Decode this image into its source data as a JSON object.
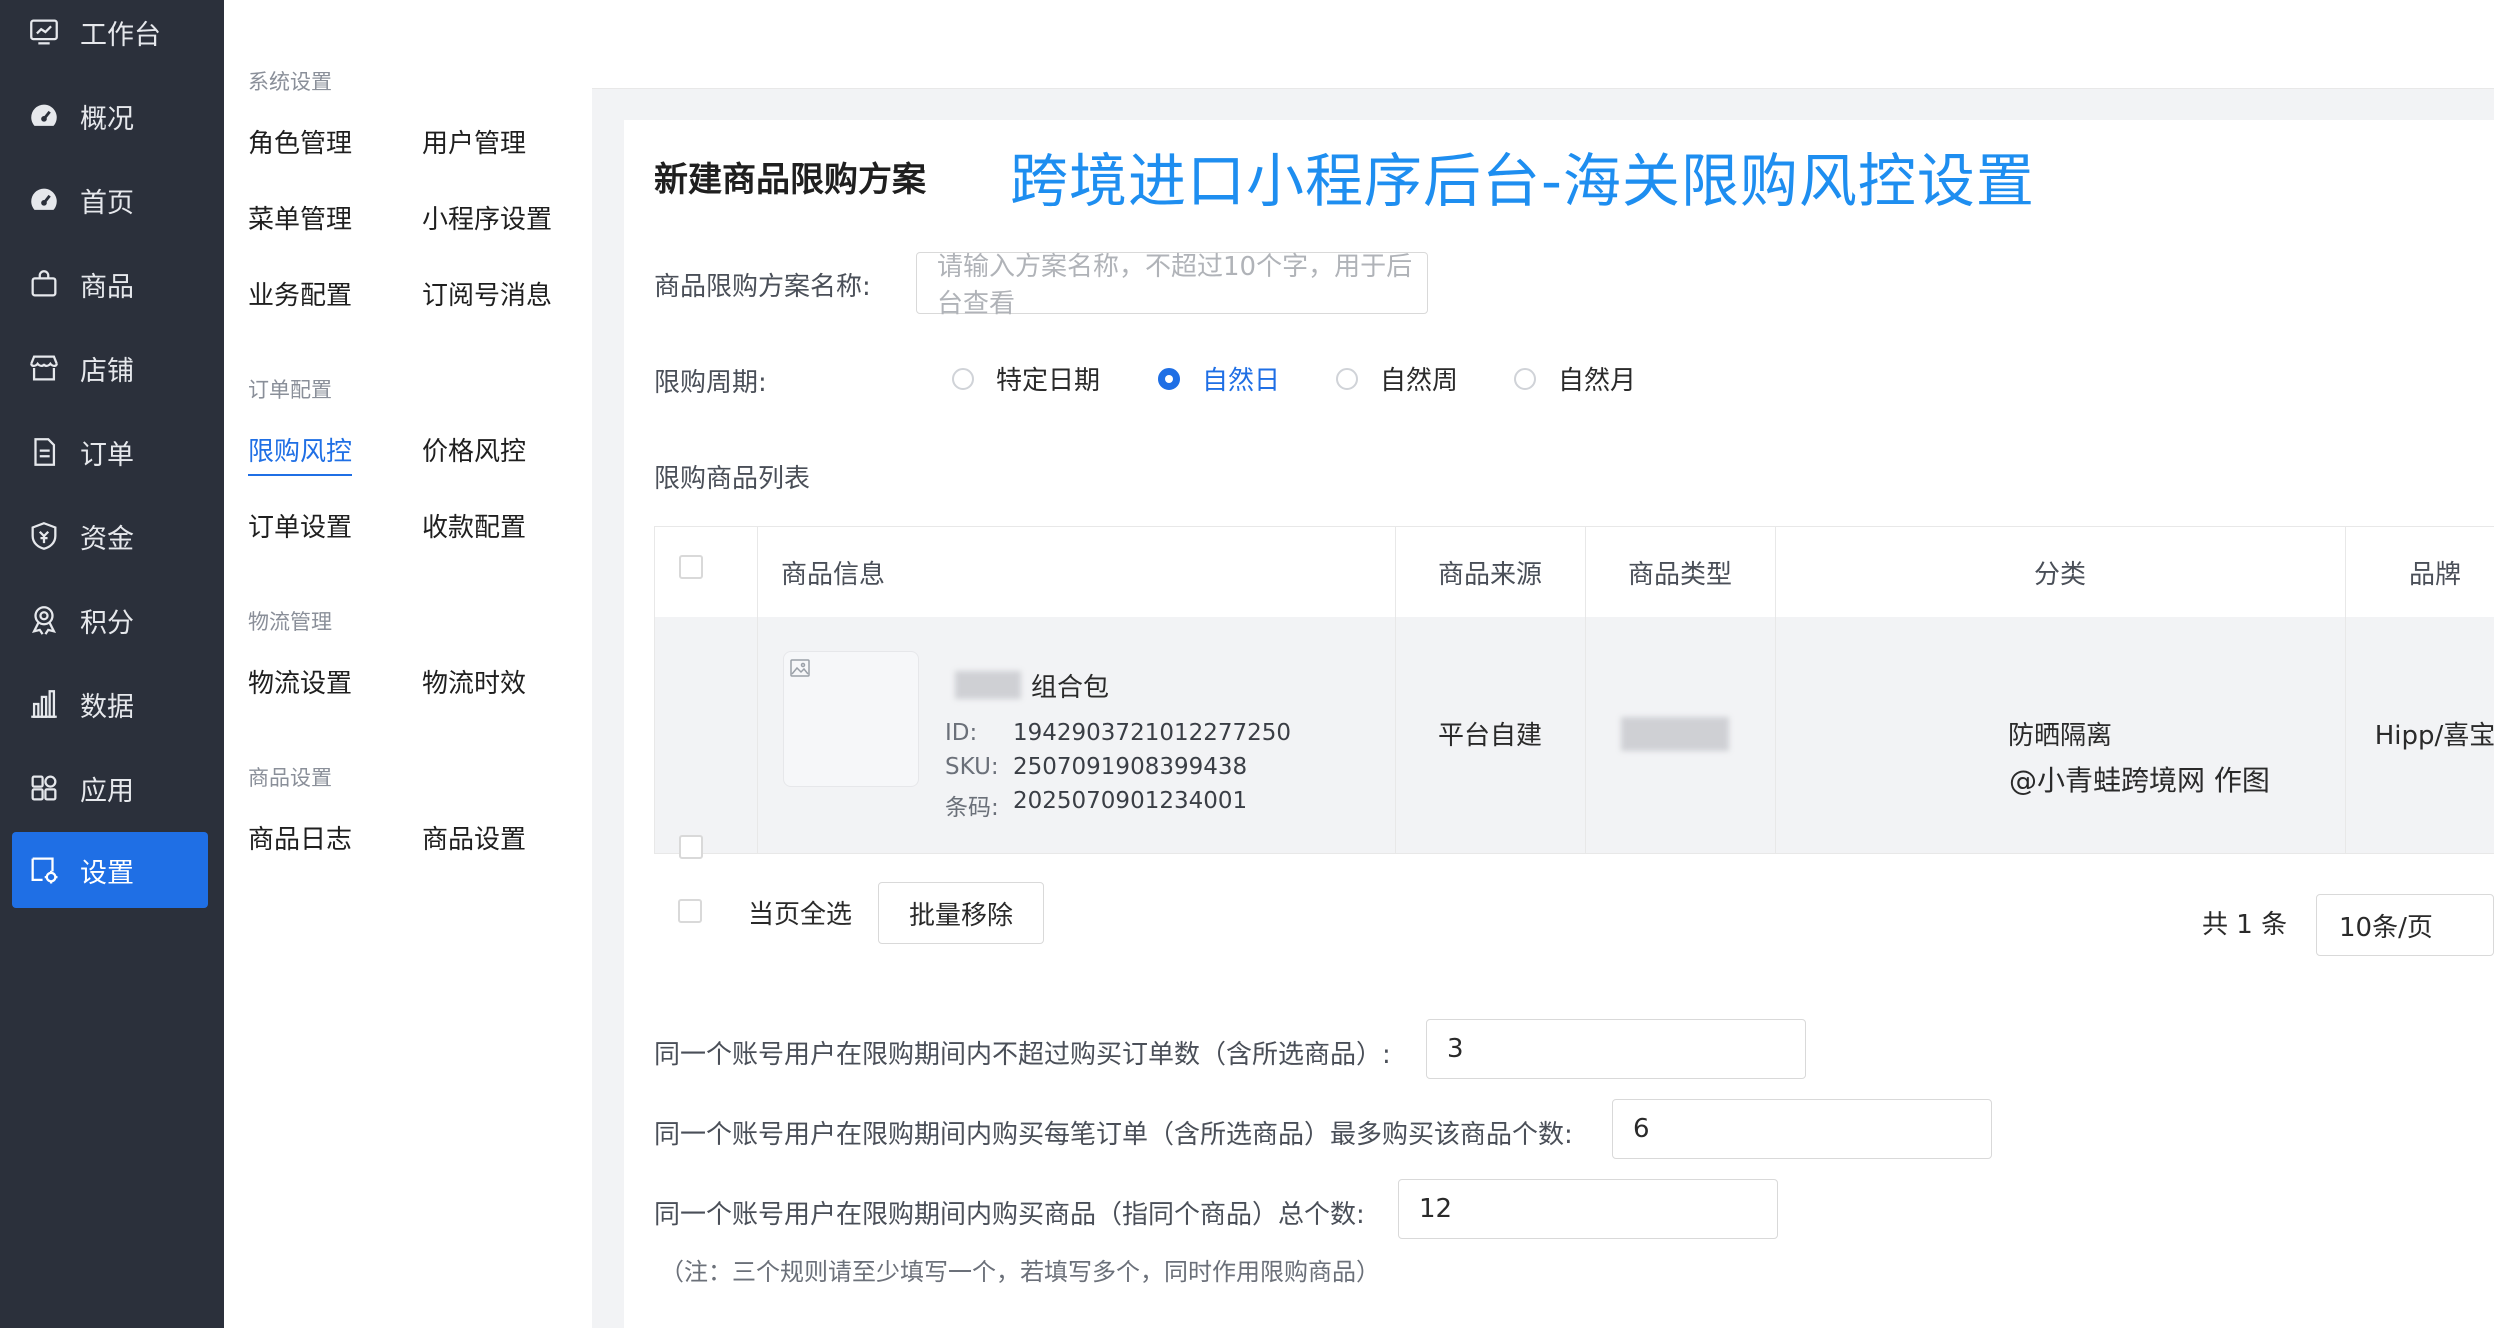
{
  "sidebar": {
    "items": [
      {
        "label": "工作台",
        "icon": "monitor-icon"
      },
      {
        "label": "概况",
        "icon": "dashboard-gauge-icon"
      },
      {
        "label": "首页",
        "icon": "home-gauge-icon"
      },
      {
        "label": "商品",
        "icon": "shopping-bag-icon"
      },
      {
        "label": "店铺",
        "icon": "store-icon"
      },
      {
        "label": "订单",
        "icon": "order-document-icon"
      },
      {
        "label": "资金",
        "icon": "funds-shield-icon"
      },
      {
        "label": "积分",
        "icon": "points-medal-icon"
      },
      {
        "label": "数据",
        "icon": "bar-chart-icon"
      },
      {
        "label": "应用",
        "icon": "apps-grid-icon"
      },
      {
        "label": "设置",
        "icon": "settings-icon"
      }
    ],
    "active": "设置",
    "active_color": "#1f6fe5"
  },
  "submenu": {
    "groups": [
      {
        "title": "系统设置",
        "links": [
          "角色管理",
          "用户管理",
          "菜单管理",
          "小程序设置",
          "业务配置",
          "订阅号消息"
        ]
      },
      {
        "title": "订单配置",
        "links": [
          "限购风控",
          "价格风控",
          "订单设置",
          "收款配置"
        ]
      },
      {
        "title": "物流管理",
        "links": [
          "物流设置",
          "物流时效"
        ]
      },
      {
        "title": "商品设置",
        "links": [
          "商品日志",
          "商品设置"
        ]
      }
    ],
    "active": "限购风控"
  },
  "page": {
    "title": "新建商品限购方案",
    "banner": "跨境进口小程序后台-海关限购风控设置",
    "name_label": "商品限购方案名称:",
    "name_placeholder": "请输入方案名称，不超过10个字，用于后台查看",
    "period_label": "限购周期:",
    "period_options": [
      "特定日期",
      "自然日",
      "自然周",
      "自然月"
    ],
    "period_selected": "自然日",
    "list_label": "限购商品列表"
  },
  "table": {
    "columns": [
      "商品信息",
      "商品来源",
      "商品类型",
      "分类",
      "品牌"
    ],
    "rows": [
      {
        "name": "组合包",
        "id_label": "ID:",
        "id": "1942903721012277250",
        "sku_label": "SKU:",
        "sku": "2507091908399438",
        "barcode_label": "条码:",
        "barcode": "2025070901234001",
        "source": "平台自建",
        "category": "防晒隔离",
        "brand": "Hipp/喜宝"
      }
    ],
    "watermark": "@小青蛙跨境网 作图"
  },
  "footer": {
    "select_all": "当页全选",
    "batch_remove": "批量移除",
    "total": "共 1 条",
    "page_size": "10条/页"
  },
  "rules": {
    "orders_label": "同一个账号用户在限购期间内不超过购买订单数（含所选商品）:",
    "orders_value": "3",
    "per_order_label": "同一个账号用户在限购期间内购买每笔订单（含所选商品）最多购买该商品个数:",
    "per_order_value": "6",
    "total_label": "同一个账号用户在限购期间内购买商品（指同个商品）总个数:",
    "total_value": "12",
    "note": "（注：三个规则请至少填写一个，若填写多个，同时作用限购商品）"
  }
}
